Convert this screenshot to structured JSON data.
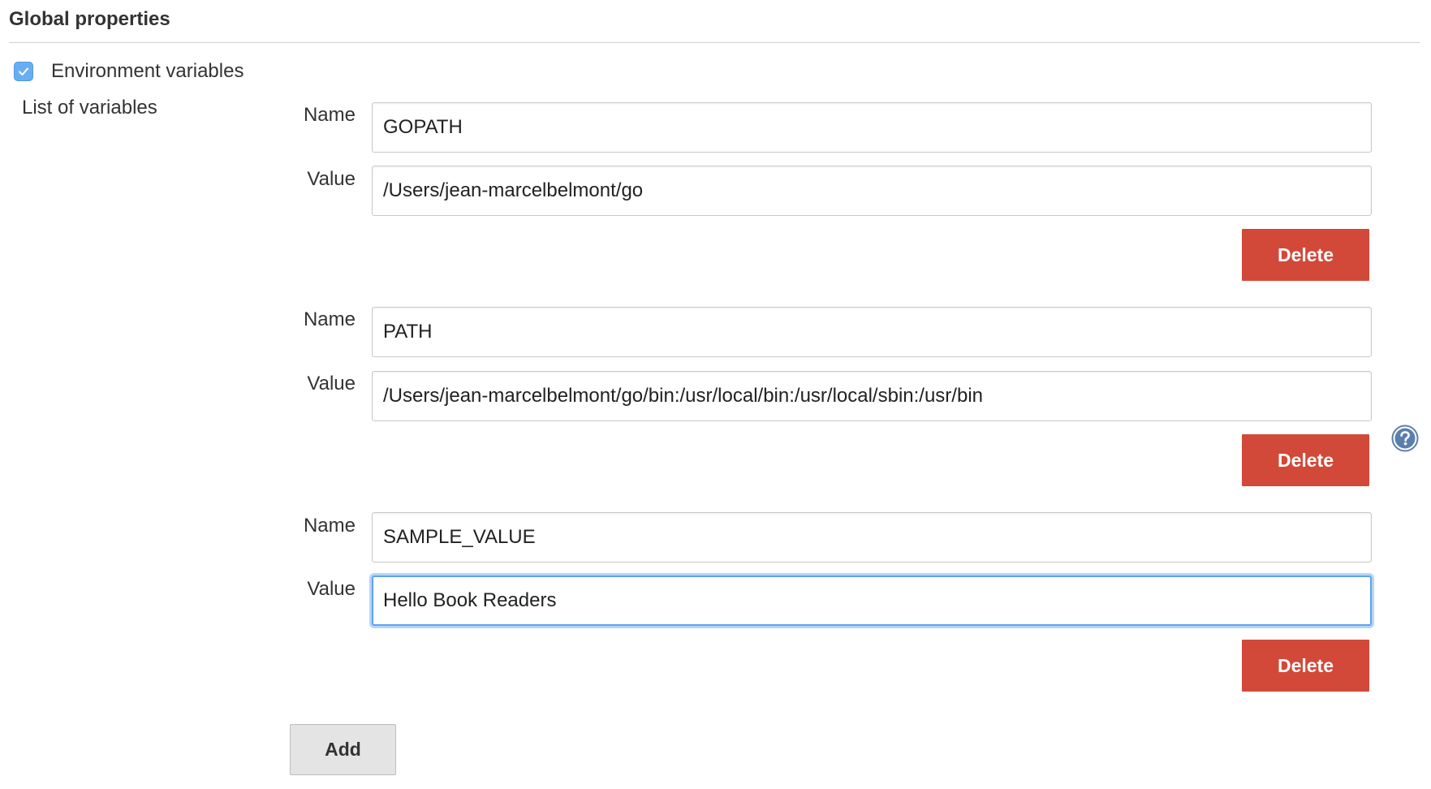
{
  "section": {
    "title": "Global properties"
  },
  "env_vars": {
    "checkbox_label": "Environment variables",
    "checked": true,
    "list_label": "List of variables",
    "name_label": "Name",
    "value_label": "Value",
    "delete_label": "Delete",
    "add_label": "Add",
    "help_icon": "help-question-icon",
    "accent_color": "#6aaef2",
    "delete_color": "#d24939",
    "variables": [
      {
        "name": "GOPATH",
        "value": "/Users/jean-marcelbelmont/go"
      },
      {
        "name": "PATH",
        "value": "/Users/jean-marcelbelmont/go/bin:/usr/local/bin:/usr/local/sbin:/usr/bin"
      },
      {
        "name": "SAMPLE_VALUE",
        "value": "Hello Book Readers"
      }
    ]
  }
}
